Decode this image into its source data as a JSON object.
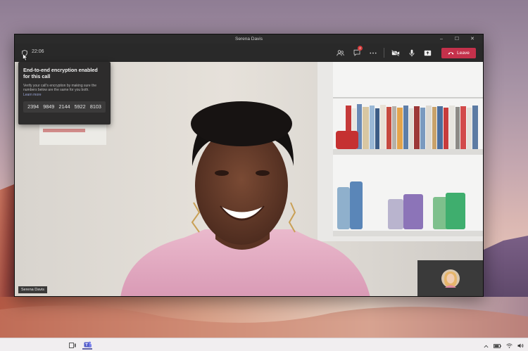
{
  "window": {
    "title": "Serena Davis",
    "controls": {
      "minimize": "–",
      "maximize": "☐",
      "close": "✕"
    }
  },
  "toolbar": {
    "call_timer": "22:06",
    "chat_badge_count": "2",
    "leave_label": "Leave",
    "icons": [
      "shield-icon",
      "participants-icon",
      "chat-icon",
      "more-icon",
      "camera-off-icon",
      "microphone-icon",
      "share-icon",
      "phone-icon"
    ]
  },
  "encryption_popover": {
    "title": "End-to-end encryption enabled for this call",
    "description": "Verify your call's encryption by making sure the numbers below are the same for you both.",
    "link": "Learn more",
    "codes": [
      "2394",
      "9849",
      "2144",
      "5922",
      "8103"
    ]
  },
  "video": {
    "participant_name": "Serena Davis"
  },
  "colors": {
    "leave": "#c4314b",
    "accent": "#6264a7",
    "window_bg": "#1f1f1f",
    "popover_bg": "#2d2c2c",
    "badge": "#d63c3c"
  }
}
